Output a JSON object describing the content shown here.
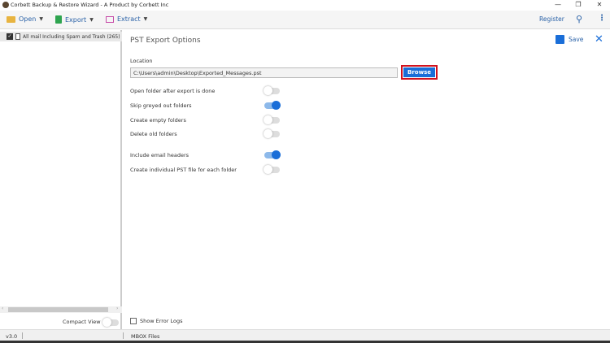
{
  "window": {
    "title": "Corbett Backup & Restore Wizard - A Product by Corbett Inc",
    "minimize": "—",
    "restore": "❐",
    "close": "✕"
  },
  "toolbar": {
    "open": "Open",
    "export": "Export",
    "extract": "Extract",
    "register": "Register"
  },
  "sidebar": {
    "item": "All mail Including Spam and Trash (265)",
    "compact_view": "Compact View",
    "compact_on": false
  },
  "panel": {
    "title": "PST Export Options",
    "save": "Save",
    "location_label": "Location",
    "location_value": "C:\\Users\\admin\\Desktop\\Exported_Messages.pst",
    "browse": "Browse",
    "options": [
      {
        "label": "Open folder after export is done",
        "on": false
      },
      {
        "label": "Skip greyed out folders",
        "on": true
      },
      {
        "label": "Create empty folders",
        "on": false
      },
      {
        "label": "Delete old folders",
        "on": false
      },
      {
        "label": "Include email headers",
        "on": true
      },
      {
        "label": "Create individual PST file for each folder",
        "on": false
      }
    ],
    "show_error_logs": "Show Error Logs"
  },
  "status": {
    "version": "v3.0",
    "type": "MBOX Files"
  },
  "colors": {
    "accent": "#1a6ed8",
    "highlight": "#d1121e"
  }
}
